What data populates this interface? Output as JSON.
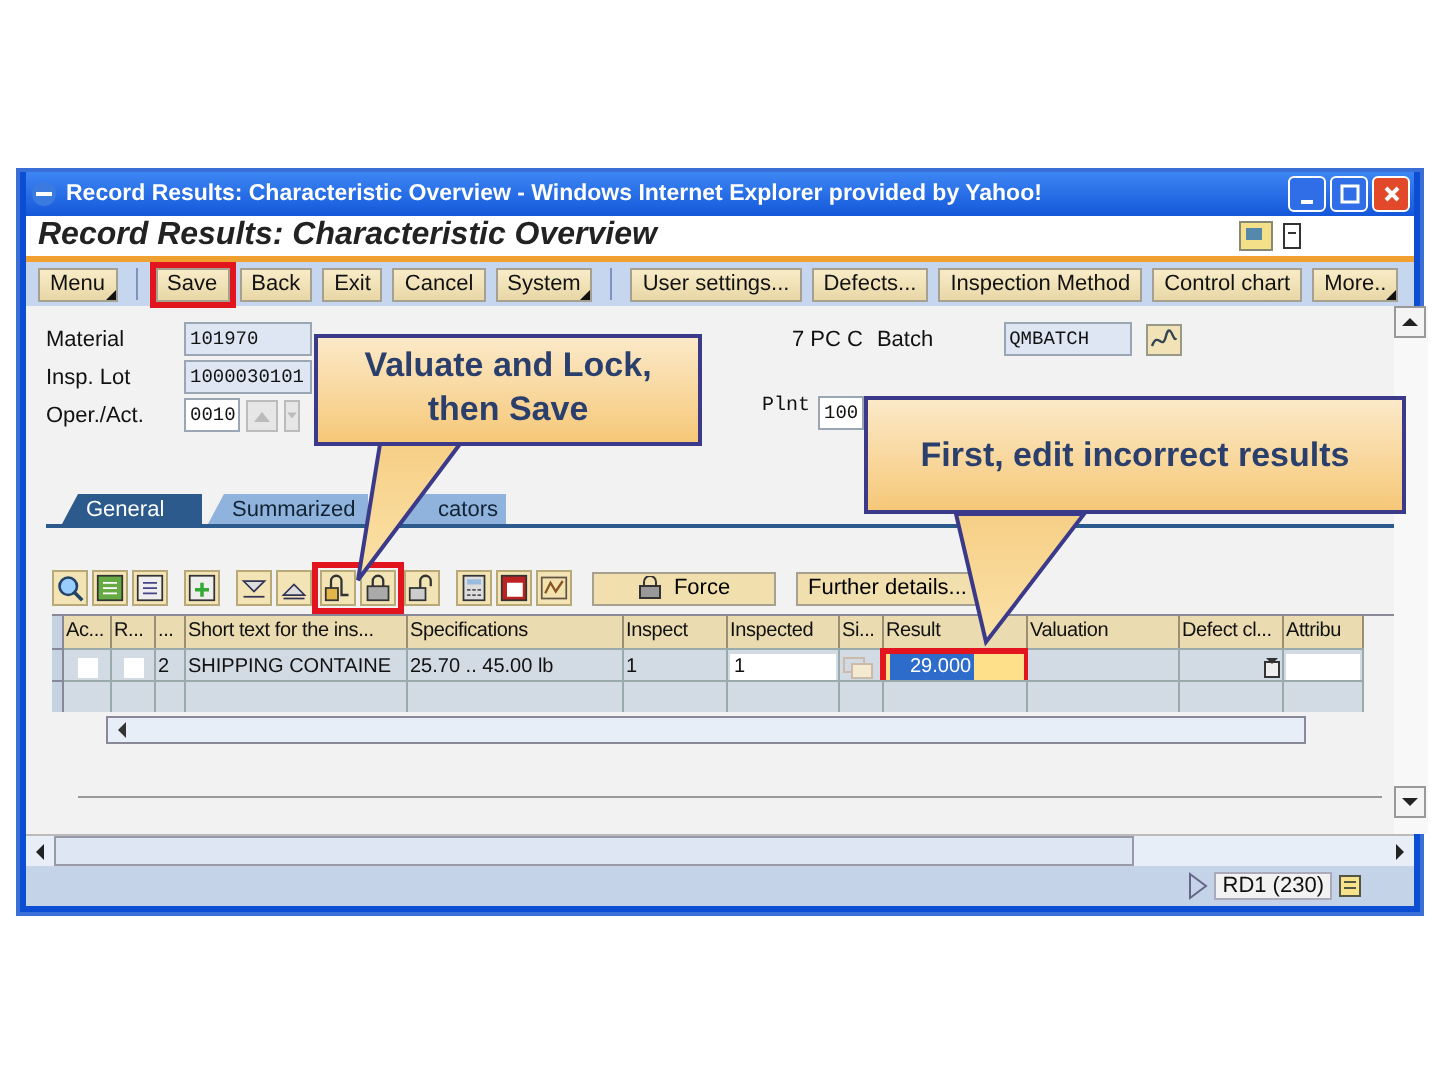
{
  "window": {
    "title": "Record Results: Characteristic Overview - Windows Internet Explorer provided by Yahoo!"
  },
  "header_title": "Record Results: Characteristic Overview",
  "toolbar": {
    "groups": [
      [
        {
          "label": "Menu",
          "menu": true,
          "highlighted": false
        }
      ],
      [
        {
          "label": "Save",
          "menu": false,
          "highlighted": true
        },
        {
          "label": "Back",
          "menu": false,
          "highlighted": false
        },
        {
          "label": "Exit",
          "menu": false,
          "highlighted": false
        },
        {
          "label": "Cancel",
          "menu": false,
          "highlighted": false
        },
        {
          "label": "System",
          "menu": true,
          "highlighted": false
        }
      ],
      [
        {
          "label": "User settings...",
          "menu": false,
          "highlighted": false
        },
        {
          "label": "Defects...",
          "menu": false,
          "highlighted": false
        },
        {
          "label": "Inspection Method",
          "menu": false,
          "highlighted": false
        },
        {
          "label": "Control chart",
          "menu": false,
          "highlighted": false
        },
        {
          "label": "More..",
          "menu": true,
          "highlighted": false
        }
      ]
    ]
  },
  "form": {
    "material_label": "Material",
    "material": "101970",
    "material_description": "7 PC C",
    "batch_label": "Batch",
    "batch": "QMBATCH",
    "lot_label": "Insp. Lot",
    "lot": "1000030101",
    "oper_label": "Oper./Act.",
    "oper": "0010",
    "plant_label": "Plnt",
    "plant": "100"
  },
  "tabs": [
    {
      "label": "General",
      "selected": true
    },
    {
      "label": "Summarized",
      "selected": false
    },
    {
      "label": "cators",
      "selected": false
    }
  ],
  "table_toolbar": {
    "lock_icons_highlighted": true,
    "buttons": [
      "Force",
      "Further details..."
    ]
  },
  "table": {
    "columns": [
      "Ac...",
      "R...",
      "...",
      "Short text for the ins...",
      "Specifications",
      "Inspect",
      "Inspected",
      "Si...",
      "Result",
      "Valuation",
      "Defect cl...",
      "Attribu"
    ],
    "rows": [
      {
        "ac_checked": false,
        "r_checked": false,
        "number": "2",
        "short_text": "SHIPPING CONTAINE",
        "specifications": "25.70 .. 45.00 lb",
        "inspect": "1",
        "inspected": "1",
        "result": "29.000",
        "result_highlighted": true,
        "valuation": "",
        "attribute": ""
      }
    ]
  },
  "status_bar": {
    "system": "RD1 (230)"
  },
  "callouts": [
    {
      "text": "Valuate and Lock, then Save"
    },
    {
      "text": "First, edit incorrect results"
    }
  ]
}
